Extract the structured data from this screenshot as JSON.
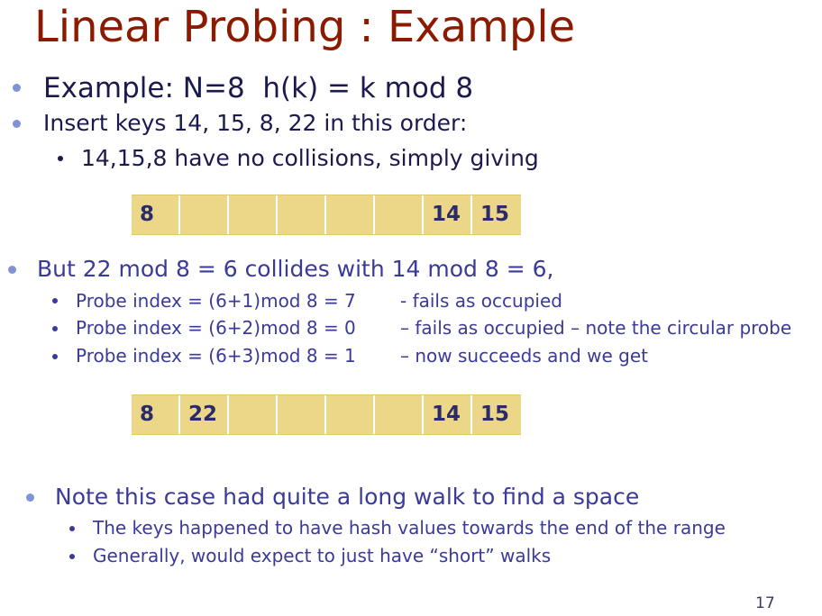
{
  "slide": {
    "title": "Linear Probing : Example",
    "page_number": "17"
  },
  "bullets": {
    "b1": "Example: N=8  h(k) = k mod 8",
    "b2": "Insert keys 14, 15, 8, 22 in this order:",
    "b2_1": "14,15,8 have no collisions, simply giving",
    "b3": "But 22 mod 8 = 6 collides with 14 mod 8 = 6,",
    "probes": [
      {
        "expr": "Probe index = (6+1)mod 8 = 7",
        "note": "- fails as occupied"
      },
      {
        "expr": "Probe index = (6+2)mod 8 = 0",
        "note": "– fails as occupied – note the circular probe"
      },
      {
        "expr": "Probe index = (6+3)mod 8 = 1",
        "note": "– now succeeds and we get"
      }
    ],
    "b4": "Note this case had quite a long walk to find a space",
    "b4_1": "The keys happened to have hash values towards the end of the range",
    "b4_2": "Generally, would expect to just have “short” walks"
  },
  "table1": {
    "cells": [
      "8",
      "",
      "",
      "",
      "",
      "",
      "14",
      "15"
    ]
  },
  "table2": {
    "cells": [
      "8",
      "22",
      "",
      "",
      "",
      "",
      "14",
      "15"
    ]
  },
  "colors": {
    "title": "#8b1a00",
    "text_dark": "#1a1a4e",
    "text_blue": "#3a3a9a",
    "cell_fill": "#ecd687",
    "bullet": "#7f93d6"
  }
}
